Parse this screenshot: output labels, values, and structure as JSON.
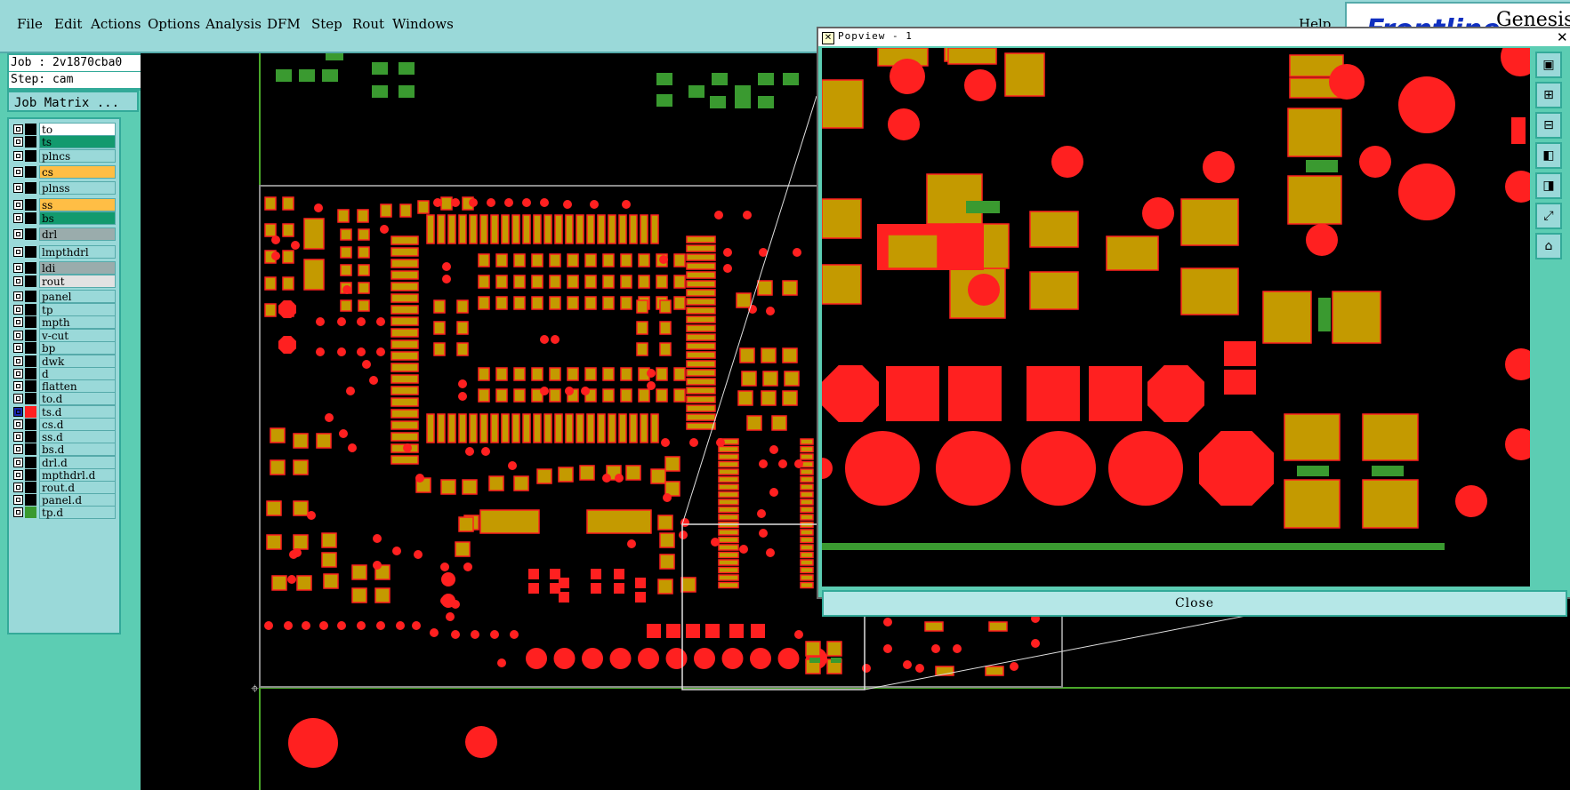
{
  "menu": {
    "items": [
      "File",
      "Edit",
      "Actions",
      "Options",
      "Analysis",
      "DFM",
      "Step",
      "Rout",
      "Windows"
    ],
    "help": "Help"
  },
  "brand": {
    "logo": "Frontline",
    "product": "Genesis"
  },
  "job": {
    "job_line": "Job : 2v1870cba0",
    "step_line": "Step: cam",
    "matrix_label": "Job Matrix ..."
  },
  "layers": [
    {
      "name": "to",
      "color": "#ffffff",
      "swatch": "#000000"
    },
    {
      "name": "ts",
      "color": "#129a6e",
      "swatch": "#000000"
    },
    {
      "name": "plncs",
      "color": "#9ad9d9",
      "swatch": "#000000"
    },
    {
      "name": "cs",
      "color": "#ffbe45",
      "swatch": "#000000"
    },
    {
      "name": "plnss",
      "color": "#9ad9d9",
      "swatch": "#000000"
    },
    {
      "name": "ss",
      "color": "#ffbe45",
      "swatch": "#000000"
    },
    {
      "name": "bs",
      "color": "#129a6e",
      "swatch": "#000000"
    },
    {
      "name": "drl",
      "color": "#9aacac",
      "swatch": "#000000"
    },
    {
      "name": "lmpthdrl",
      "color": "#9ad9d9",
      "swatch": "#000000"
    },
    {
      "name": "ldi",
      "color": "#9aacac",
      "swatch": "#000000"
    },
    {
      "name": "rout",
      "color": "#e2e2e2",
      "swatch": "#000000"
    },
    {
      "name": "panel",
      "color": "#9ad9d9",
      "swatch": "#000000"
    },
    {
      "name": "tp",
      "color": "#9ad9d9",
      "swatch": "#000000"
    },
    {
      "name": "mpth",
      "color": "#9ad9d9",
      "swatch": "#000000"
    },
    {
      "name": "v-cut",
      "color": "#9ad9d9",
      "swatch": "#000000"
    },
    {
      "name": "bp",
      "color": "#9ad9d9",
      "swatch": "#000000"
    },
    {
      "name": "dwk",
      "color": "#9ad9d9",
      "swatch": "#000000"
    },
    {
      "name": "d",
      "color": "#9ad9d9",
      "swatch": "#000000"
    },
    {
      "name": "flatten",
      "color": "#9ad9d9",
      "swatch": "#000000"
    },
    {
      "name": "to.d",
      "color": "#9ad9d9",
      "swatch": "#000000"
    },
    {
      "name": "ts.d",
      "color": "#9ad9d9",
      "swatch": "#ff2020",
      "active": true
    },
    {
      "name": "cs.d",
      "color": "#9ad9d9",
      "swatch": "#000000"
    },
    {
      "name": "ss.d",
      "color": "#9ad9d9",
      "swatch": "#000000"
    },
    {
      "name": "bs.d",
      "color": "#9ad9d9",
      "swatch": "#000000"
    },
    {
      "name": "drl.d",
      "color": "#9ad9d9",
      "swatch": "#000000"
    },
    {
      "name": "mpthdrl.d",
      "color": "#9ad9d9",
      "swatch": "#000000"
    },
    {
      "name": "rout.d",
      "color": "#9ad9d9",
      "swatch": "#000000"
    },
    {
      "name": "panel.d",
      "color": "#9ad9d9",
      "swatch": "#000000"
    },
    {
      "name": "tp.d",
      "color": "#9ad9d9",
      "swatch": "#3a9a30"
    }
  ],
  "popview": {
    "title": "Popview - 1",
    "close_label": "Close",
    "tool_icons": [
      "zoom-window-icon",
      "zoom-in-icon",
      "zoom-out-icon",
      "pan-left-icon",
      "pan-right-icon",
      "fit-icon",
      "zoom-home-icon"
    ]
  },
  "colors": {
    "pad": "#c49a00",
    "outline": "#ff2020",
    "green": "#3a9a30",
    "profile": "#8a8a8a",
    "frame": "#4aa82a"
  }
}
